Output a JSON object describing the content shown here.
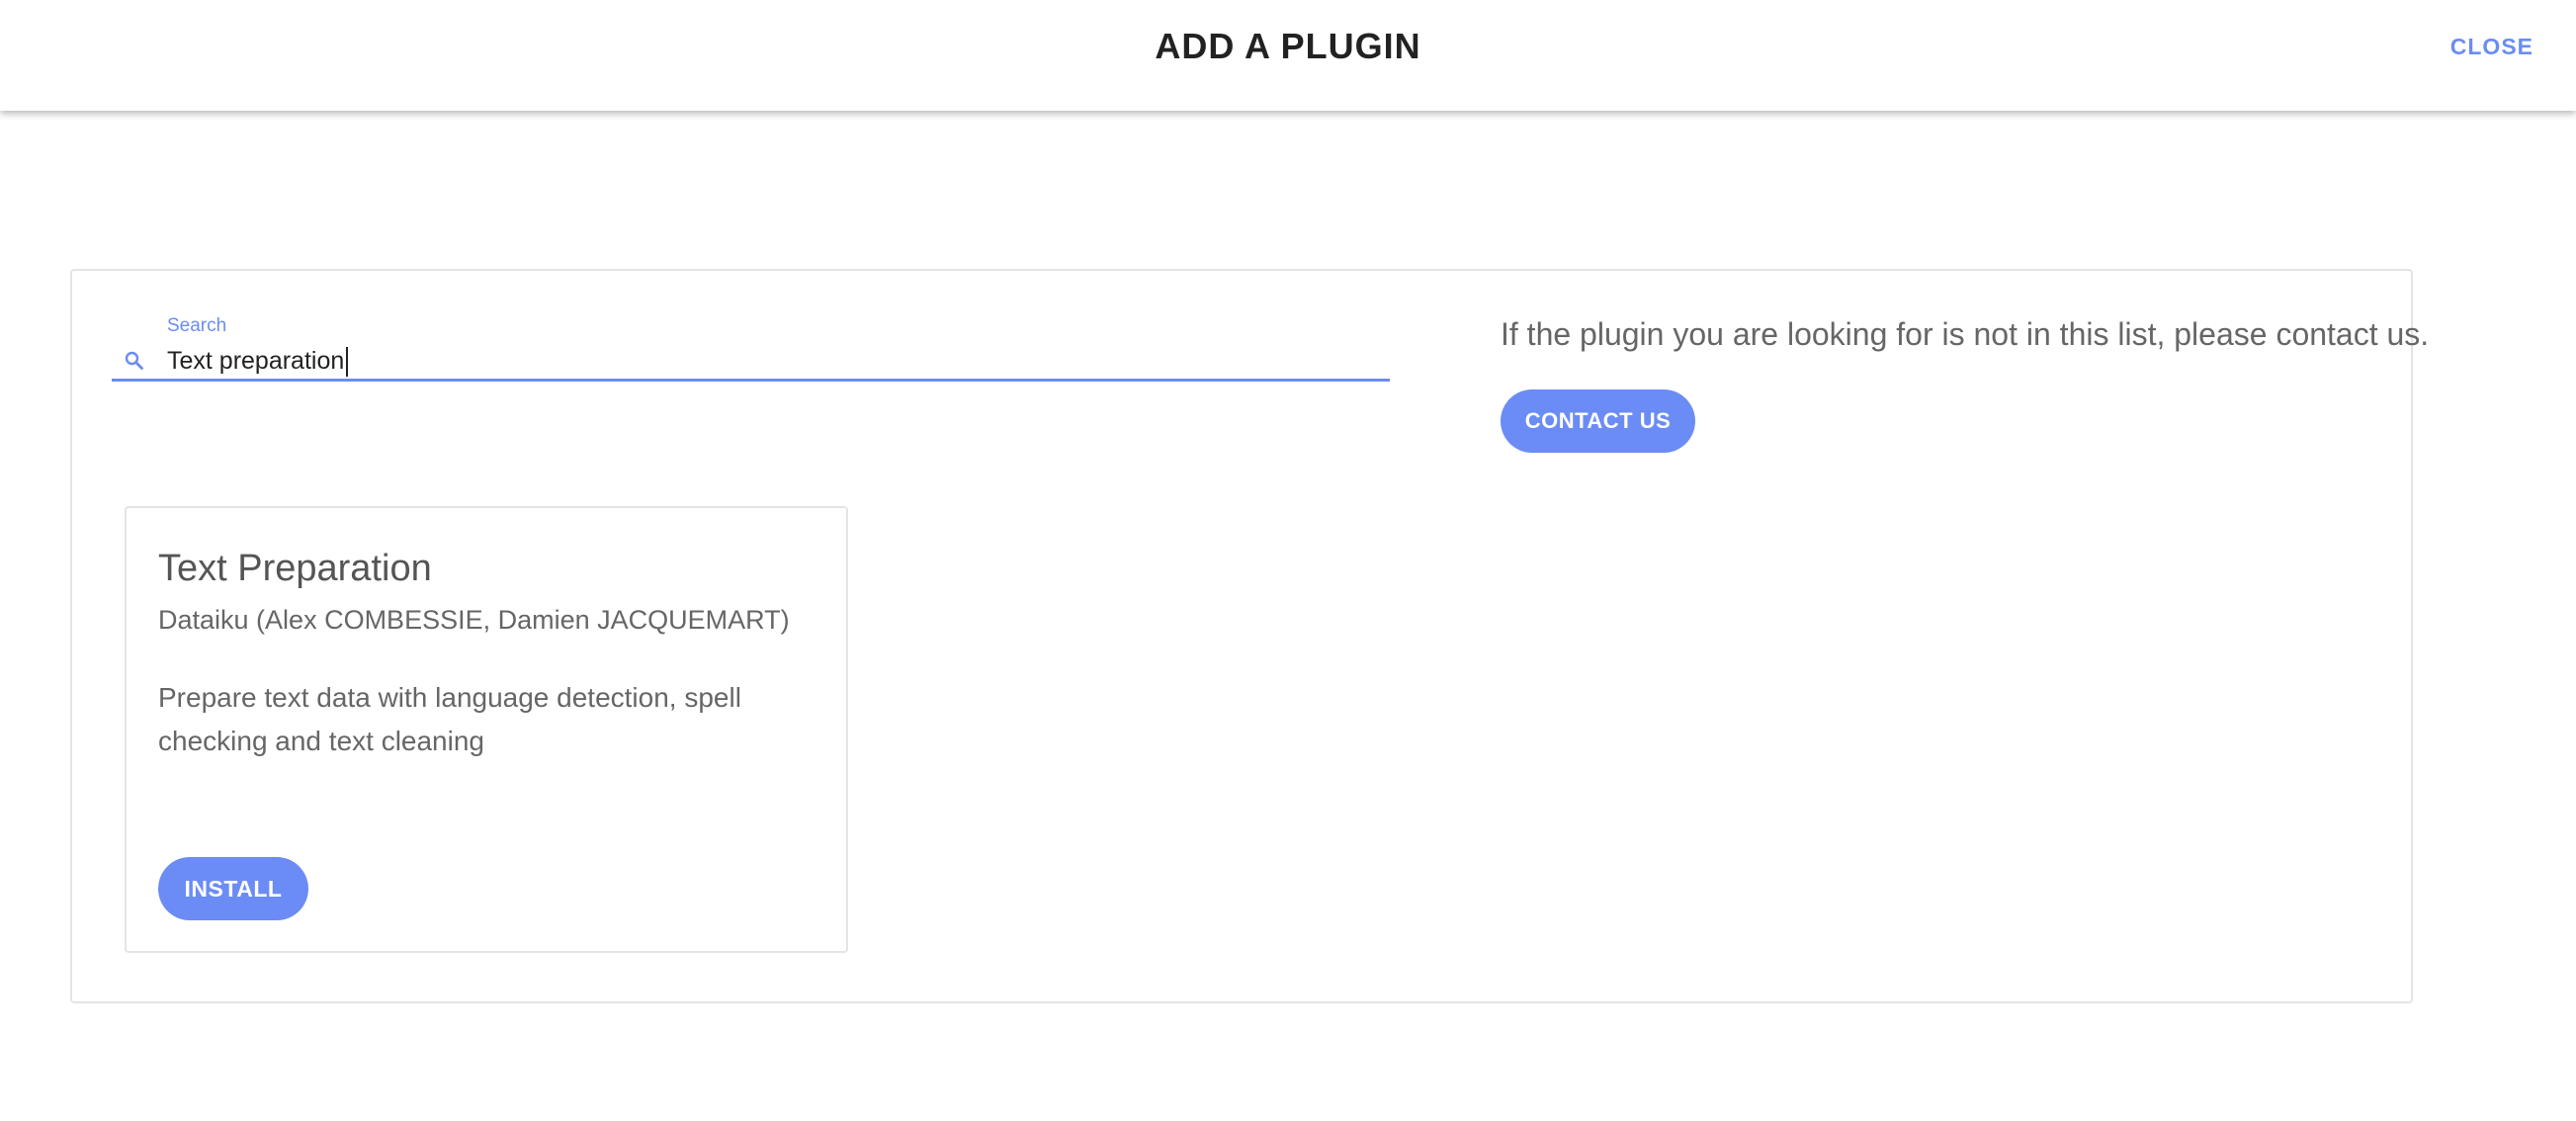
{
  "header": {
    "title": "ADD A PLUGIN",
    "close_label": "CLOSE"
  },
  "search": {
    "label": "Search",
    "value": "Text preparation",
    "icon": "search-icon"
  },
  "contact": {
    "message": "If the plugin you are looking for is not in this list, please contact us.",
    "button_label": "CONTACT US"
  },
  "results": [
    {
      "title": "Text Preparation",
      "author": "Dataiku (Alex COMBESSIE, Damien JACQUEMART)",
      "description": "Prepare text data with language detection, spell checking and text cleaning",
      "button_label": "INSTALL"
    }
  ],
  "colors": {
    "accent": "#6b8cf5",
    "title_text": "#222222",
    "body_text": "#666666",
    "border": "#e4e4e4"
  }
}
